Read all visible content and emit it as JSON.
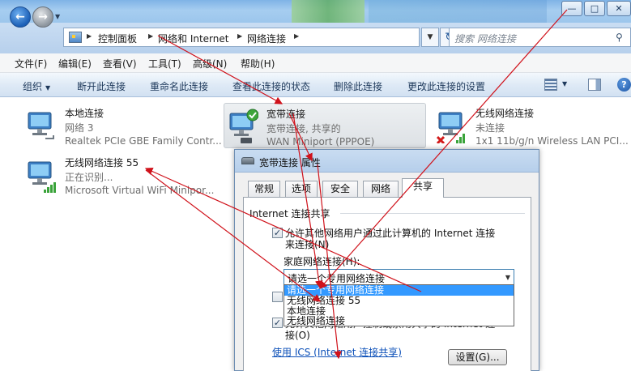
{
  "window": {
    "controls": {
      "minimize": "—",
      "maximize": "□",
      "close": "✕"
    }
  },
  "address": {
    "segments": [
      "控制面板",
      "网络和 Internet",
      "网络连接"
    ],
    "search_placeholder": "搜索 网络连接"
  },
  "menu": [
    "文件(F)",
    "编辑(E)",
    "查看(V)",
    "工具(T)",
    "高级(N)",
    "帮助(H)"
  ],
  "toolbar": {
    "organize": "组织",
    "commands": [
      "断开此连接",
      "重命名此连接",
      "查看此连接的状态",
      "删除此连接",
      "更改此连接的设置"
    ],
    "help": "?"
  },
  "connections": [
    {
      "name": "本地连接",
      "status": "网络  3",
      "device": "Realtek PCIe GBE Family Contr...",
      "icon": "wired-network-icon"
    },
    {
      "name": "宽带连接",
      "status": "宽带连接, 共享的",
      "device": "WAN Miniport (PPPOE)",
      "icon": "broadband-connection-icon"
    },
    {
      "name": "无线网络连接",
      "status": "未连接",
      "device": "1x1 11b/g/n Wireless LAN PCI...",
      "icon": "wireless-network-icon"
    },
    {
      "name": "无线网络连接 55",
      "status": "正在识别...",
      "device": "Microsoft Virtual WiFi Minipor...",
      "icon": "virtual-wifi-icon"
    }
  ],
  "dialog": {
    "title": "宽带连接 属性",
    "tabs": [
      "常规",
      "选项",
      "安全",
      "网络",
      "共享"
    ],
    "group_label": "Internet 连接共享",
    "allow_sharing_line1": "允许其他网络用户通过此计算机的 Internet 连接",
    "allow_sharing_line2": "来连接(N)",
    "home_network_label": "家庭网络连接(H):",
    "combo_value": "请选一个专用网络连接",
    "dropdown_options": [
      "请选一个专用网络连接",
      "无线网络连接 55",
      "本地连接",
      "无线网络连接"
    ],
    "second_checkbox_line1": "允许其他网络用户控制或禁用共享的 Internet 连",
    "second_checkbox_line2": "接(O)",
    "link": "使用 ICS (Internet 连接共享)",
    "settings_button": "设置(G)..."
  },
  "colors": {
    "annotation_arrow": "#d0121b",
    "selection": "#3399ff",
    "link": "#0b4fb8"
  }
}
